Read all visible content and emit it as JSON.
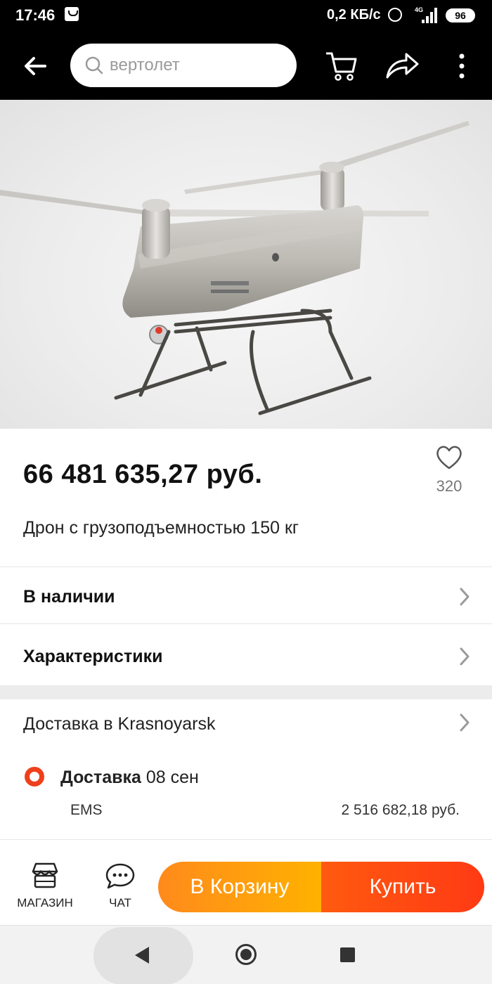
{
  "status_bar": {
    "time": "17:46",
    "network_speed": "0,2 КБ/с",
    "network_type": "4G",
    "battery": "96",
    "icons": [
      "shopping-bag-icon",
      "alarm-icon",
      "signal-icon",
      "battery-icon"
    ]
  },
  "top_bar": {
    "search_text": "вертолет",
    "icons": [
      "back-arrow-icon",
      "search-icon",
      "cart-icon",
      "share-icon",
      "more-vertical-icon"
    ]
  },
  "product": {
    "image_subject": "drone-helicopter",
    "price": "66 481 635,27 руб.",
    "favorites_count": "320",
    "title": "Дрон с грузоподъемностью 150 кг"
  },
  "rows": {
    "availability": "В наличии",
    "specs": "Характеристики"
  },
  "delivery": {
    "destination": "Доставка в Krasnoyarsk",
    "label": "Доставка",
    "date": "08 сен",
    "carrier": "EMS",
    "price": "2 516 682,18 руб."
  },
  "bottom_bar": {
    "store_label": "МАГАЗИН",
    "chat_label": "ЧАТ",
    "add_to_cart": "В Корзину",
    "buy": "Купить"
  },
  "colors": {
    "accent_orange": "#ff9a14",
    "accent_red": "#ff4a12",
    "delivery_dot": "#ef3f1c"
  }
}
